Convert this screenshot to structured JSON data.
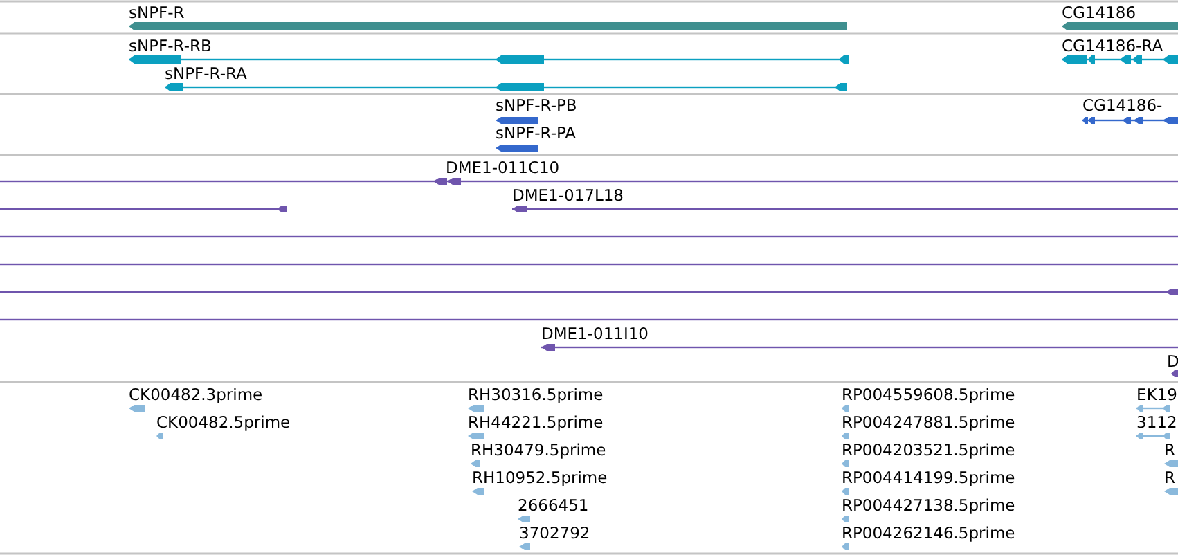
{
  "tracks": [
    {
      "kind": "gene",
      "features": [
        {
          "label": "sNPF-R"
        },
        {
          "label": "CG14186"
        }
      ]
    },
    {
      "kind": "transcript",
      "features": [
        {
          "label": "sNPF-R-RB"
        },
        {
          "label": "sNPF-R-RA"
        },
        {
          "label": "CG14186-RA"
        }
      ]
    },
    {
      "kind": "protein",
      "features": [
        {
          "label": "sNPF-R-PB"
        },
        {
          "label": "sNPF-R-PA"
        },
        {
          "label": "CG14186-"
        }
      ]
    },
    {
      "kind": "clone",
      "features": [
        {
          "label": "DME1-011C10"
        },
        {
          "label": "DME1-017L18"
        },
        {
          "label": "DME1-011I10"
        },
        {
          "label": "D"
        }
      ]
    },
    {
      "kind": "est",
      "features": [
        {
          "label": "CK00482.3prime"
        },
        {
          "label": "CK00482.5prime"
        },
        {
          "label": "RH30316.5prime"
        },
        {
          "label": "RH44221.5prime"
        },
        {
          "label": "RH30479.5prime"
        },
        {
          "label": "RH10952.5prime"
        },
        {
          "label": "2666451"
        },
        {
          "label": "3702792"
        },
        {
          "label": "RP004559608.5prime"
        },
        {
          "label": "RP004247881.5prime"
        },
        {
          "label": "RP004203521.5prime"
        },
        {
          "label": "RP004414199.5prime"
        },
        {
          "label": "RP004427138.5prime"
        },
        {
          "label": "RP004262146.5prime"
        },
        {
          "label": "EK19"
        },
        {
          "label": "3112"
        },
        {
          "label": "R"
        },
        {
          "label": "R"
        }
      ]
    }
  ]
}
